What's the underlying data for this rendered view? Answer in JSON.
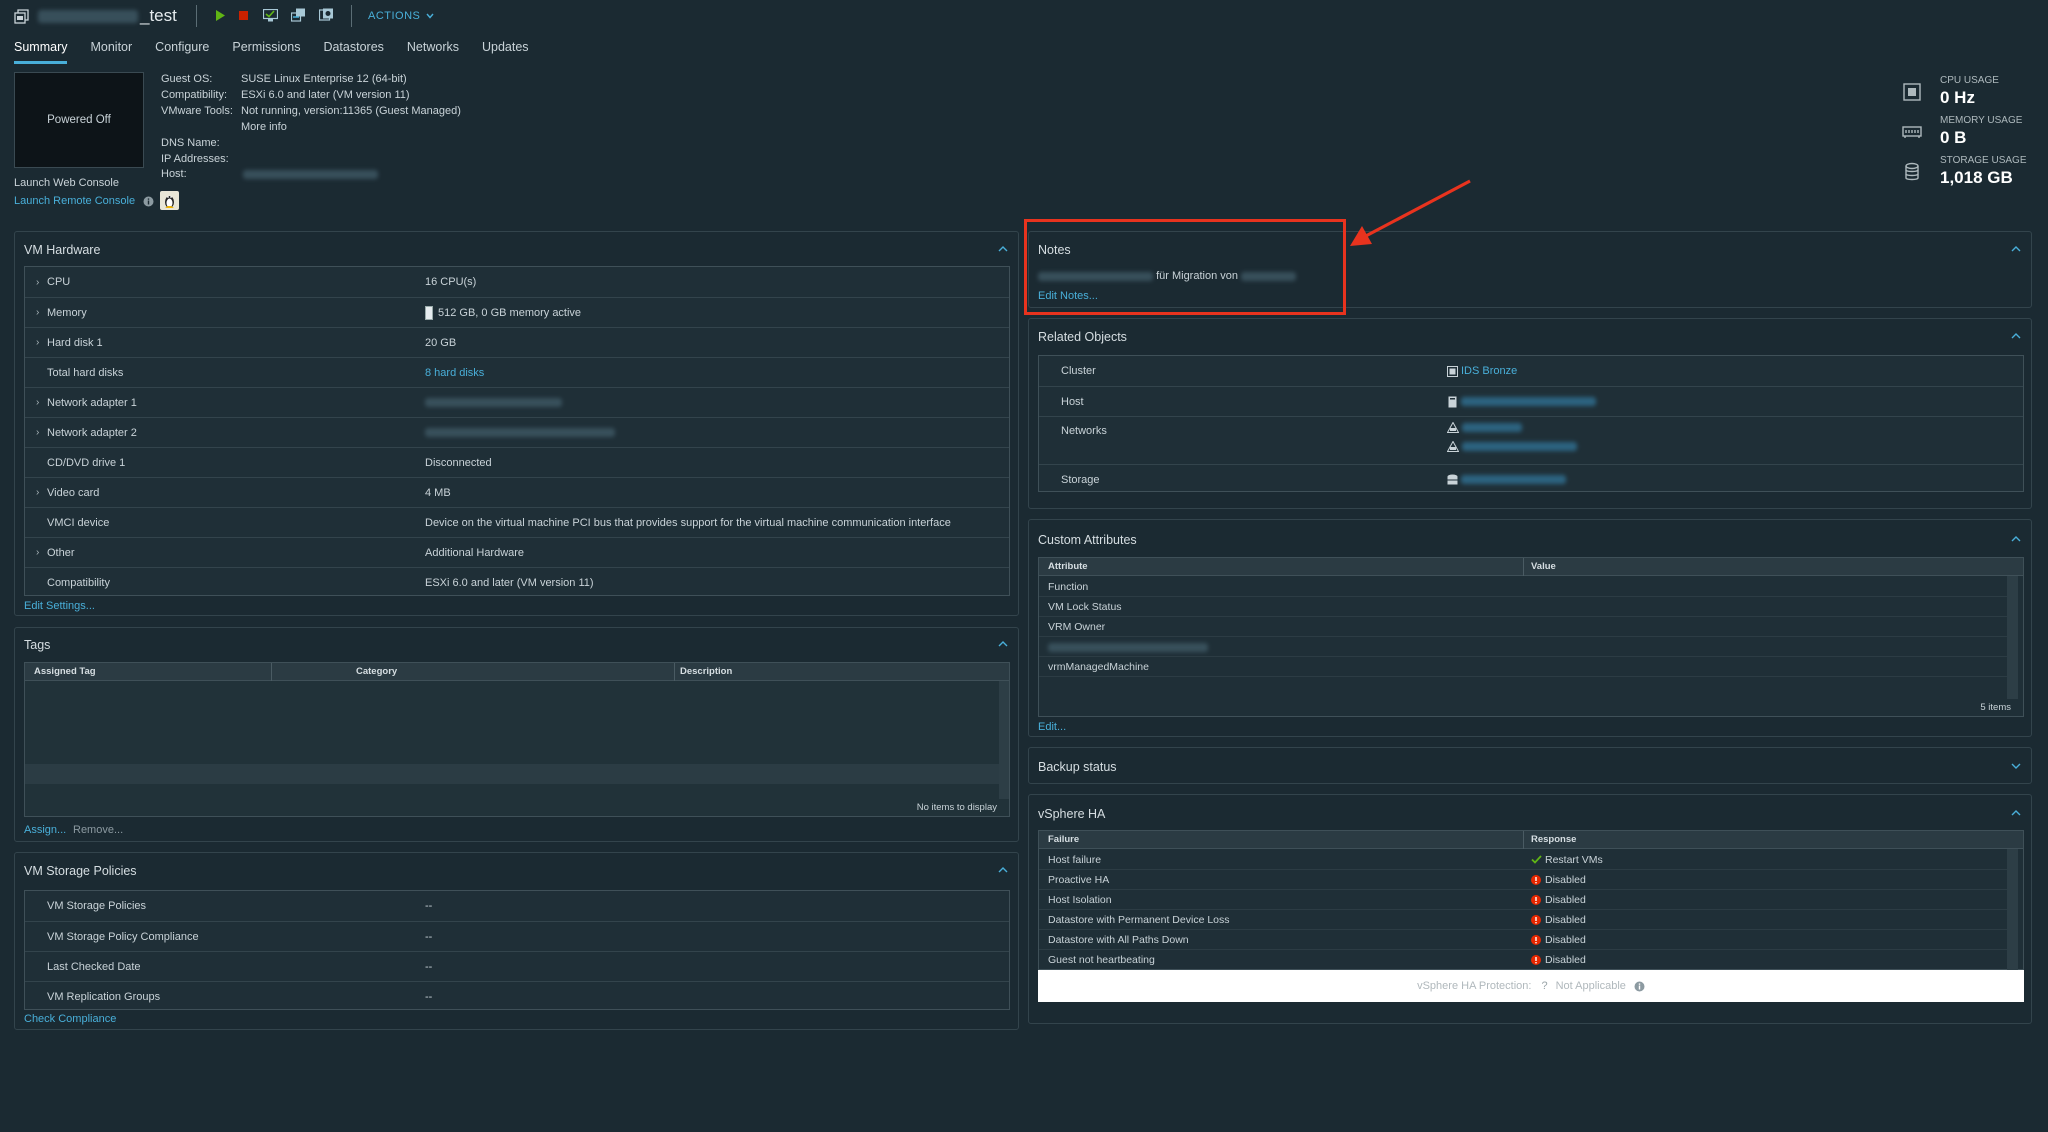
{
  "header": {
    "title_suffix": "_test",
    "actions_label": "ACTIONS"
  },
  "tabs": [
    {
      "label": "Summary",
      "active": true
    },
    {
      "label": "Monitor"
    },
    {
      "label": "Configure"
    },
    {
      "label": "Permissions"
    },
    {
      "label": "Datastores"
    },
    {
      "label": "Networks"
    },
    {
      "label": "Updates"
    }
  ],
  "summary": {
    "thumbnail_status": "Powered Off",
    "launch_web_console": "Launch Web Console",
    "launch_remote_console": "Launch Remote Console",
    "info": [
      {
        "label": "Guest OS:",
        "value": "SUSE Linux Enterprise 12 (64-bit)"
      },
      {
        "label": "Compatibility:",
        "value": "ESXi 6.0 and later (VM version 11)"
      },
      {
        "label": "VMware Tools:",
        "value": "Not running, version:11365 (Guest Managed)"
      },
      {
        "label": "",
        "value": "More info"
      },
      {
        "label": "DNS Name:",
        "value": ""
      },
      {
        "label": "IP Addresses:",
        "value": ""
      },
      {
        "label": "Host:",
        "value": ""
      }
    ]
  },
  "usage": [
    {
      "label": "CPU USAGE",
      "value": "0 Hz",
      "icon": "cpu-icon"
    },
    {
      "label": "MEMORY USAGE",
      "value": "0 B",
      "icon": "memory-icon"
    },
    {
      "label": "STORAGE USAGE",
      "value": "1,018 GB",
      "icon": "storage-icon"
    }
  ],
  "vm_hardware": {
    "title": "VM Hardware",
    "rows": [
      {
        "label": "CPU",
        "value": "16 CPU(s)",
        "expandable": true
      },
      {
        "label": "Memory",
        "value": "512 GB, 0 GB memory active",
        "expandable": true
      },
      {
        "label": "Hard disk 1",
        "value": "20 GB",
        "expandable": true
      },
      {
        "label": "Total hard disks",
        "value": "8 hard disks",
        "expandable": false,
        "link": true
      },
      {
        "label": "Network adapter 1",
        "value": "",
        "expandable": true
      },
      {
        "label": "Network adapter 2",
        "value": "",
        "expandable": true
      },
      {
        "label": "CD/DVD drive 1",
        "value": "Disconnected",
        "expandable": false
      },
      {
        "label": "Video card",
        "value": "4 MB",
        "expandable": true
      },
      {
        "label": "VMCI device",
        "value": "Device on the virtual machine PCI bus that provides support for the virtual machine communication interface",
        "expandable": false
      },
      {
        "label": "Other",
        "value": "Additional Hardware",
        "expandable": true
      },
      {
        "label": "Compatibility",
        "value": "ESXi 6.0 and later (VM version 11)",
        "expandable": false
      }
    ],
    "edit_settings": "Edit Settings..."
  },
  "tags": {
    "title": "Tags",
    "columns": [
      "Assigned Tag",
      "Category",
      "Description"
    ],
    "empty_text": "No items to display",
    "assign": "Assign...",
    "remove": "Remove..."
  },
  "storage_policies": {
    "title": "VM Storage Policies",
    "rows": [
      {
        "label": "VM Storage Policies",
        "value": "--"
      },
      {
        "label": "VM Storage Policy Compliance",
        "value": "--"
      },
      {
        "label": "Last Checked Date",
        "value": "--"
      },
      {
        "label": "VM Replication Groups",
        "value": "--"
      }
    ],
    "check_compliance": "Check Compliance"
  },
  "notes": {
    "title": "Notes",
    "text_middle": "für Migration von",
    "edit": "Edit Notes..."
  },
  "related_objects": {
    "title": "Related Objects",
    "rows": [
      {
        "label": "Cluster",
        "value": "IDS Bronze"
      },
      {
        "label": "Host",
        "value": ""
      },
      {
        "label": "Networks",
        "value": ""
      },
      {
        "label": "Storage",
        "value": ""
      }
    ]
  },
  "custom_attributes": {
    "title": "Custom Attributes",
    "columns": [
      "Attribute",
      "Value"
    ],
    "rows": [
      "Function",
      "VM Lock Status",
      "VRM Owner",
      "",
      "vrmManagedMachine"
    ],
    "count": "5 items",
    "edit": "Edit..."
  },
  "backup_status": {
    "title": "Backup status"
  },
  "vsphere_ha": {
    "title": "vSphere HA",
    "columns": [
      "Failure",
      "Response"
    ],
    "rows": [
      {
        "failure": "Host failure",
        "response": "Restart VMs",
        "status": "ok"
      },
      {
        "failure": "Proactive HA",
        "response": "Disabled",
        "status": "error"
      },
      {
        "failure": "Host Isolation",
        "response": "Disabled",
        "status": "error"
      },
      {
        "failure": "Datastore with Permanent Device Loss",
        "response": "Disabled",
        "status": "error"
      },
      {
        "failure": "Datastore with All Paths Down",
        "response": "Disabled",
        "status": "error"
      },
      {
        "failure": "Guest not heartbeating",
        "response": "Disabled",
        "status": "error"
      }
    ],
    "protection_label": "vSphere HA Protection:",
    "protection_value": "Not Applicable"
  },
  "colors": {
    "accent": "#49afd9",
    "error": "#e62700",
    "success": "#60b515",
    "highlight": "#e8331e"
  }
}
